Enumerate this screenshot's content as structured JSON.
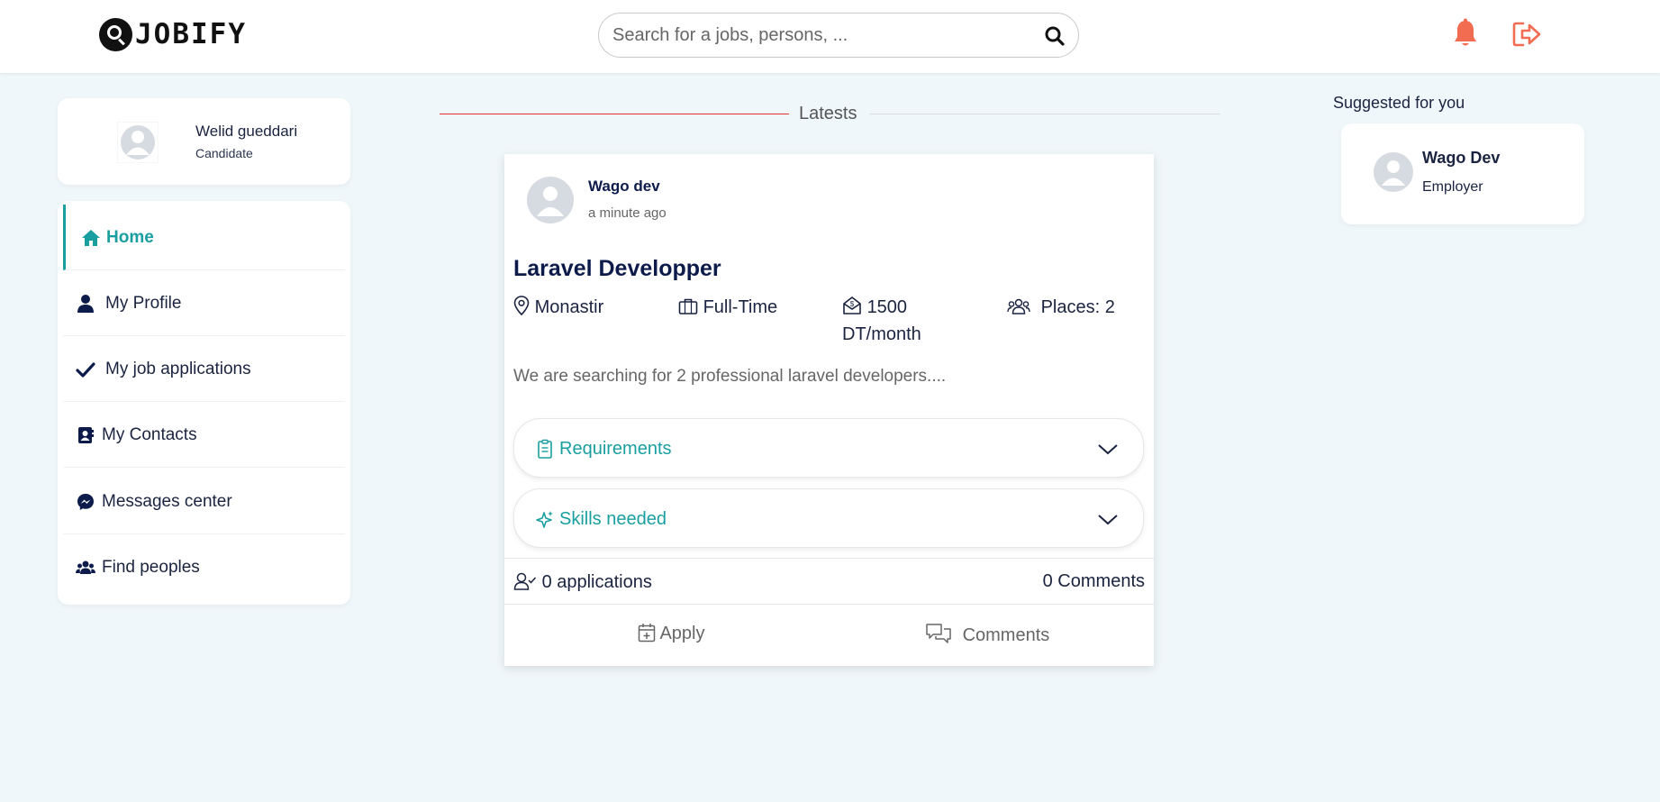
{
  "app": {
    "name": "JOBIFY"
  },
  "search": {
    "placeholder": "Search for a jobs, persons, ..."
  },
  "colors": {
    "accent": "#1a9fa0",
    "alert": "#f26c52",
    "navy": "#0d1b4b",
    "divider_red": "#e0312f"
  },
  "header": {
    "icons": [
      "search-icon",
      "bell-icon",
      "logout-icon"
    ]
  },
  "user": {
    "name": "Welid gueddari",
    "role": "Candidate"
  },
  "sidebar": {
    "items": [
      {
        "label": "Home",
        "icon": "home-icon",
        "active": true
      },
      {
        "label": "My Profile",
        "icon": "user-icon"
      },
      {
        "label": "My job applications",
        "icon": "check-icon"
      },
      {
        "label": "My Contacts",
        "icon": "contact-book-icon"
      },
      {
        "label": "Messages center",
        "icon": "messenger-icon"
      },
      {
        "label": "Find peoples",
        "icon": "users-icon"
      }
    ]
  },
  "feed": {
    "heading": "Latests"
  },
  "post": {
    "author": "Wago dev",
    "time": "a minute ago",
    "title": "Laravel Developper",
    "location": "Monastir",
    "type": "Full-Time",
    "salary_line1": "1500",
    "salary_line2": "DT/month",
    "places": "Places: 2",
    "description": "We are searching for 2 professional laravel developers....",
    "sections": [
      {
        "label": "Requirements",
        "icon": "clipboard-icon"
      },
      {
        "label": "Skills needed",
        "icon": "sparkle-icon"
      }
    ],
    "applications": "0 applications",
    "comments_count": "0 Comments",
    "apply_label": "Apply",
    "comments_label": "Comments"
  },
  "suggested": {
    "title": "Suggested for you",
    "people": [
      {
        "name": "Wago Dev",
        "role": "Employer"
      }
    ]
  }
}
